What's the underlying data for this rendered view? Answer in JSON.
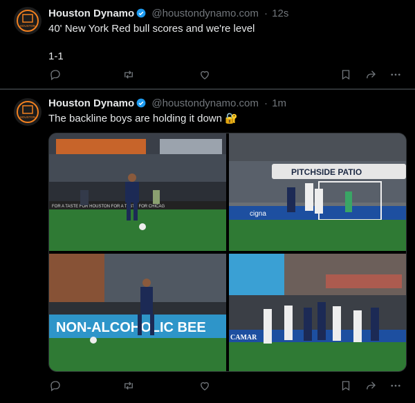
{
  "posts": [
    {
      "author": "Houston Dynamo",
      "handle": "@houstondynamo.com",
      "separator": "·",
      "time": "12s",
      "text": "40' New York Red bull scores and we're level\n\n1-1",
      "avatar_label": "HOUSTON"
    },
    {
      "author": "Houston Dynamo",
      "handle": "@houstondynamo.com",
      "separator": "·",
      "time": "1m",
      "text": "The backline boys are holding it down",
      "emoji": "🔐",
      "avatar_label": "HOUSTON",
      "images": [
        {
          "signage": "FOR A TASTE FOR    HOUSTON    FOR A TASTE FOR   CHICAG"
        },
        {
          "signage": "PITCHSIDE PATIO",
          "sponsor": "cigna"
        },
        {
          "signage": "NON-ALCOHOLIC BEE"
        },
        {
          "signage": "CAMAR"
        }
      ]
    }
  ],
  "colors": {
    "background": "#000000",
    "text": "#e7e9ea",
    "muted": "#71767b",
    "verified": "#1d9bf0",
    "divider": "#2f3336",
    "dynamo_orange": "#f4811f"
  },
  "icons": [
    "reply-icon",
    "repost-icon",
    "like-icon",
    "bookmark-icon",
    "share-icon",
    "more-icon"
  ]
}
